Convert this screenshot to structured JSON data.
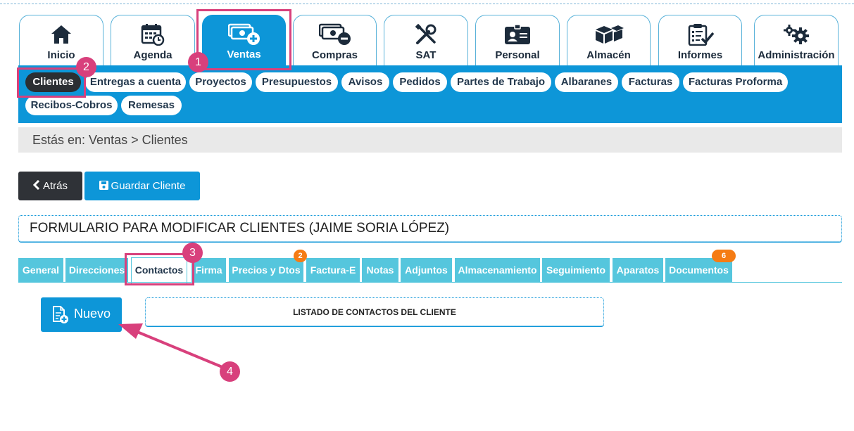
{
  "main_tabs": [
    {
      "label": "Inicio",
      "icon": "home-icon"
    },
    {
      "label": "Agenda",
      "icon": "calendar-clock-icon"
    },
    {
      "label": "Ventas",
      "icon": "money-plus-icon",
      "active": true
    },
    {
      "label": "Compras",
      "icon": "money-minus-icon"
    },
    {
      "label": "SAT",
      "icon": "tools-icon"
    },
    {
      "label": "Personal",
      "icon": "id-card-icon"
    },
    {
      "label": "Almacén",
      "icon": "boxes-icon"
    },
    {
      "label": "Informes",
      "icon": "clipboard-check-icon"
    },
    {
      "label": "Administración",
      "icon": "gears-icon"
    }
  ],
  "sub_nav": [
    {
      "label": "Clientes",
      "active": true
    },
    {
      "label": "Entregas a cuenta"
    },
    {
      "label": "Proyectos"
    },
    {
      "label": "Presupuestos"
    },
    {
      "label": "Avisos"
    },
    {
      "label": "Pedidos"
    },
    {
      "label": "Partes de Trabajo"
    },
    {
      "label": "Albaranes"
    },
    {
      "label": "Facturas"
    },
    {
      "label": "Facturas Proforma"
    },
    {
      "label": "Recibos-Cobros"
    },
    {
      "label": "Remesas"
    }
  ],
  "breadcrumb": "Estás en: Ventas > Clientes",
  "buttons": {
    "back": "Atrás",
    "save": "Guardar Cliente",
    "new": "Nuevo"
  },
  "form_title": "FORMULARIO PARA MODIFICAR CLIENTES (JAIME SORIA LÓPEZ)",
  "inner_tabs": [
    {
      "label": "General"
    },
    {
      "label": "Direcciones"
    },
    {
      "label": "Contactos",
      "active": true
    },
    {
      "label": "Firma"
    },
    {
      "label": "Precios y Dtos",
      "badge": "2"
    },
    {
      "label": "Factura-E"
    },
    {
      "label": "Notas"
    },
    {
      "label": "Adjuntos"
    },
    {
      "label": "Almacenamiento"
    },
    {
      "label": "Seguimiento"
    },
    {
      "label": "Aparatos"
    },
    {
      "label": "Documentos",
      "badge": "6"
    }
  ],
  "list_header": "LISTADO DE CONTACTOS DEL CLIENTE",
  "annotations": [
    "1",
    "2",
    "3",
    "4"
  ],
  "colors": {
    "primary": "#0d96d8",
    "tab": "#55c6dd",
    "dark": "#2f3237",
    "badge": "#f57c14",
    "annotation": "#d8407c"
  }
}
